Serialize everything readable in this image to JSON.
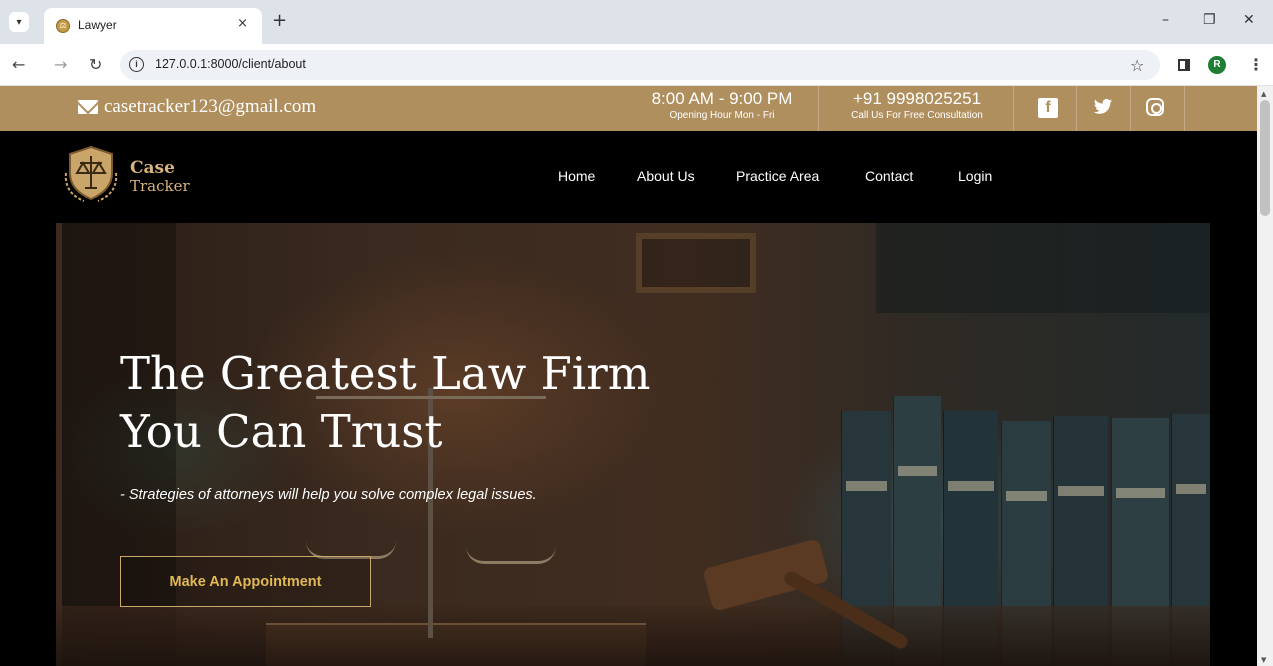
{
  "browser": {
    "tab_title": "Lawyer",
    "tab_close": "×",
    "new_tab": "+",
    "url": "127.0.0.1:8000/client/about",
    "profile_initial": "R",
    "controls": {
      "minimize": "–",
      "restore": "❐",
      "close": "✕"
    }
  },
  "topbar": {
    "email": "casetracker123@gmail.com",
    "hours_main": "8:00 AM - 9:00 PM",
    "hours_sub": "Opening Hour Mon - Fri",
    "phone_main": "+91 9998025251",
    "phone_sub": "Call Us For Free Consultation",
    "social": [
      "facebook-icon",
      "twitter-icon",
      "instagram-icon"
    ]
  },
  "logo": {
    "line1": "Case",
    "line2": "Tracker"
  },
  "nav": {
    "items": [
      {
        "label": "Home"
      },
      {
        "label": "About Us"
      },
      {
        "label": "Practice Area"
      },
      {
        "label": "Contact"
      },
      {
        "label": "Login"
      }
    ]
  },
  "hero": {
    "title_line1": "The Greatest Law Firm",
    "title_line2": "You Can Trust",
    "subtitle": "- Strategies of attorneys will help you solve complex legal issues.",
    "cta_label": "Make An Appointment"
  },
  "colors": {
    "topbar": "#b08f5e",
    "accent": "#e0b855",
    "logo": "#d6b37c"
  }
}
